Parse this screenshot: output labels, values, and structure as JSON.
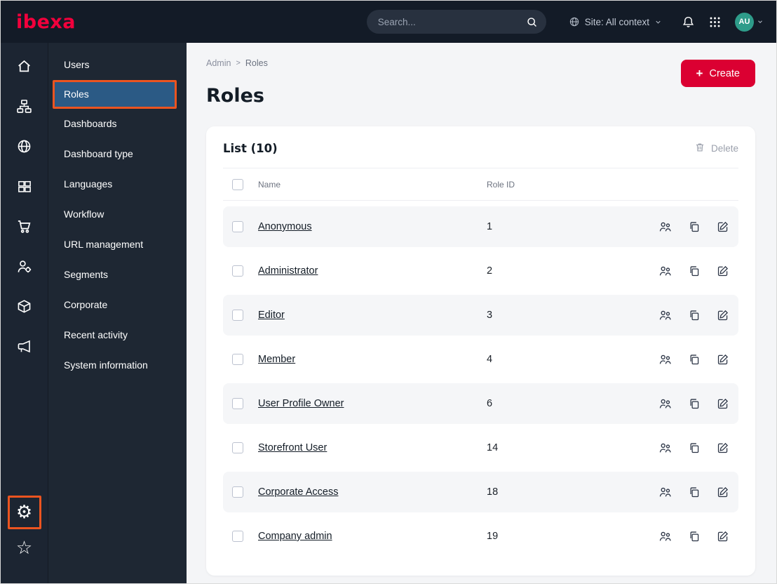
{
  "topbar": {
    "logo_text": "ibexa",
    "search_placeholder": "Search...",
    "site_context_label": "Site: All context",
    "avatar_initials": "AU"
  },
  "icon_sidebar": {
    "items": [
      "home",
      "content-tree",
      "site",
      "product-catalog",
      "commerce",
      "customers",
      "store",
      "marketing"
    ],
    "bottom": [
      "settings",
      "favorites"
    ]
  },
  "menu": {
    "items": [
      "Users",
      "Roles",
      "Dashboards",
      "Dashboard type",
      "Languages",
      "Workflow",
      "URL management",
      "Segments",
      "Corporate",
      "Recent activity",
      "System information"
    ],
    "selected": "Roles"
  },
  "main": {
    "breadcrumb": {
      "items": [
        "Admin",
        "Roles"
      ],
      "separator": ">"
    },
    "title": "Roles",
    "create_label": "Create",
    "list": {
      "title": "List (10)",
      "delete_label": "Delete",
      "columns": {
        "name": "Name",
        "role_id": "Role ID"
      },
      "rows": [
        {
          "name": "Anonymous",
          "id": "1"
        },
        {
          "name": "Administrator",
          "id": "2"
        },
        {
          "name": "Editor",
          "id": "3"
        },
        {
          "name": "Member",
          "id": "4"
        },
        {
          "name": "User Profile Owner",
          "id": "6"
        },
        {
          "name": "Storefront User",
          "id": "14"
        },
        {
          "name": "Corporate Access",
          "id": "18"
        },
        {
          "name": "Company admin",
          "id": "19"
        }
      ]
    }
  },
  "colors": {
    "brand_red": "#DB0032",
    "highlight_orange": "#EB5420",
    "selected_blue": "#2B5A85",
    "avatar_teal": "#2E9C8A",
    "topbar_bg": "#131B27"
  }
}
